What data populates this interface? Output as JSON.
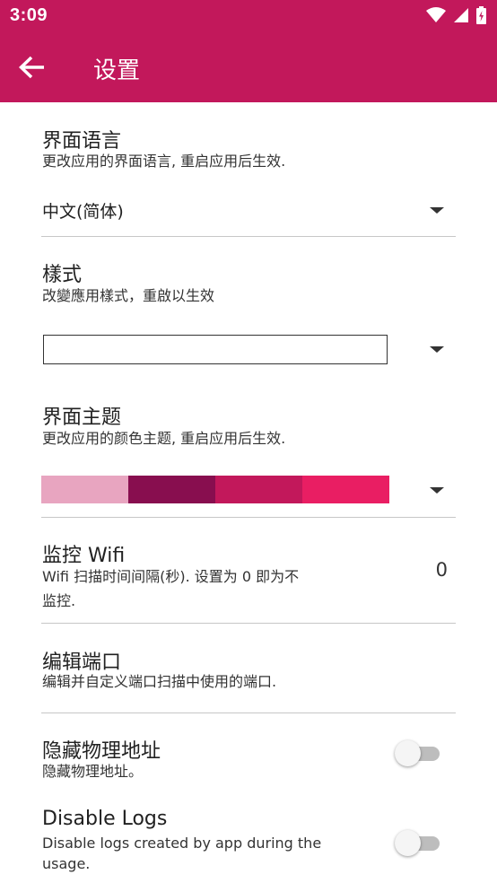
{
  "status_bar": {
    "time": "3:09",
    "icons": [
      "wifi-icon",
      "cellular-signal-icon",
      "battery-charging-icon"
    ]
  },
  "app_bar": {
    "title": "设置",
    "back_icon": "arrow-back-icon"
  },
  "settings": {
    "language": {
      "title": "界面语言",
      "summary": "更改应用的界面语言, 重启应用后生效.",
      "selected": "中文(简体)"
    },
    "style": {
      "title": "樣式",
      "summary": "改變應用樣式，重啟以生效",
      "selected": ""
    },
    "theme": {
      "title": "界面主题",
      "summary": "更改应用的颜色主题, 重启应用后生效.",
      "colors": [
        "#e8a5c0",
        "#880e4f",
        "#c2185b",
        "#e91e63"
      ]
    },
    "wifi_monitor": {
      "title": "监控 Wifi",
      "summary_line1": "Wifi 扫描时间间隔(秒). 设置为 0 即为不",
      "summary_line2": "监控.",
      "value": "0"
    },
    "edit_ports": {
      "title": "编辑端口",
      "summary": "编辑并自定义端口扫描中使用的端口."
    },
    "hide_mac": {
      "title": "隐藏物理地址",
      "summary": "隐藏物理地址。",
      "enabled": false
    },
    "disable_logs": {
      "title": "Disable Logs",
      "summary_line1": "Disable logs created by app during the",
      "summary_line2": "usage.",
      "enabled": false
    }
  },
  "colors": {
    "primary": "#c2185b",
    "divider": "#c7c7c7"
  }
}
